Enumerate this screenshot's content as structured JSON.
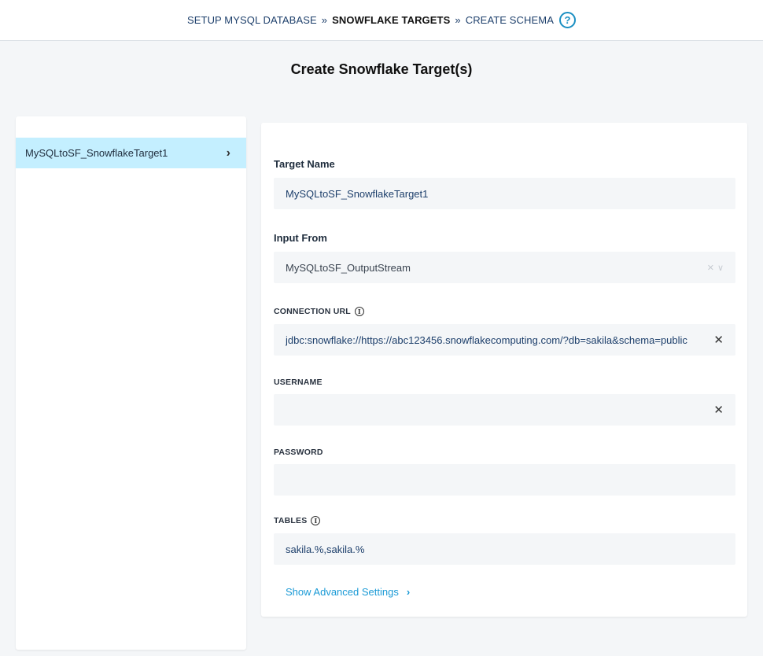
{
  "breadcrumb": {
    "steps": [
      {
        "label": "SETUP MYSQL DATABASE",
        "active": false
      },
      {
        "label": "SNOWFLAKE TARGETS",
        "active": true
      },
      {
        "label": "CREATE SCHEMA",
        "active": false
      }
    ],
    "separator": "»",
    "help_symbol": "?"
  },
  "page": {
    "title": "Create Snowflake Target(s)"
  },
  "sidebar": {
    "items": [
      {
        "label": "MySQLtoSF_SnowflakeTarget1",
        "selected": true
      }
    ]
  },
  "form": {
    "target_name": {
      "label": "Target Name",
      "value": "MySQLtoSF_SnowflakeTarget1"
    },
    "input_from": {
      "label": "Input From",
      "value": "MySQLtoSF_OutputStream"
    },
    "connection_url": {
      "label": "CONNECTION URL",
      "value": "jdbc:snowflake://https://abc123456.snowflakecomputing.com/?db=sakila&schema=public"
    },
    "username": {
      "label": "USERNAME",
      "value": ""
    },
    "password": {
      "label": "PASSWORD",
      "value": ""
    },
    "tables": {
      "label": "TABLES",
      "value": "sakila.%,sakila.%"
    },
    "advanced_label": "Show Advanced Settings"
  },
  "colors": {
    "accent": "#1a9ad6",
    "selected_item_bg": "#c4efff",
    "page_bg": "#f4f6f8"
  }
}
